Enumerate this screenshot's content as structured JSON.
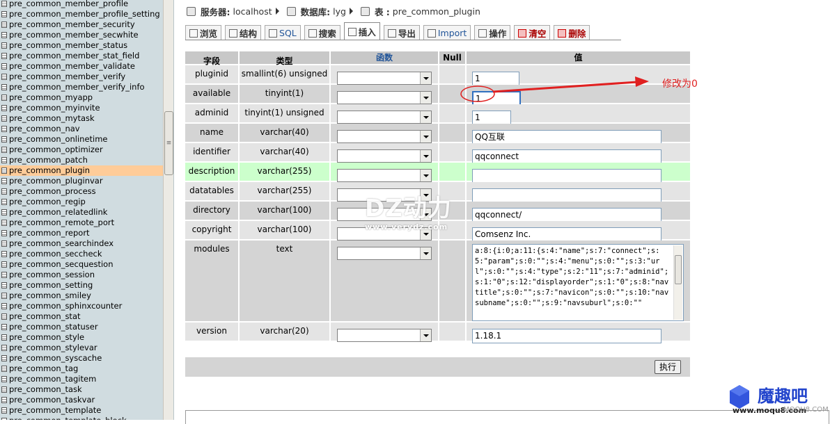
{
  "sidebar": {
    "tables": [
      "pre_common_member_profile",
      "pre_common_member_profile_setting",
      "pre_common_member_security",
      "pre_common_member_secwhite",
      "pre_common_member_status",
      "pre_common_member_stat_field",
      "pre_common_member_validate",
      "pre_common_member_verify",
      "pre_common_member_verify_info",
      "pre_common_myapp",
      "pre_common_myinvite",
      "pre_common_mytask",
      "pre_common_nav",
      "pre_common_onlinetime",
      "pre_common_optimizer",
      "pre_common_patch",
      "pre_common_plugin",
      "pre_common_pluginvar",
      "pre_common_process",
      "pre_common_regip",
      "pre_common_relatedlink",
      "pre_common_remote_port",
      "pre_common_report",
      "pre_common_searchindex",
      "pre_common_seccheck",
      "pre_common_secquestion",
      "pre_common_session",
      "pre_common_setting",
      "pre_common_smiley",
      "pre_common_sphinxcounter",
      "pre_common_stat",
      "pre_common_statuser",
      "pre_common_style",
      "pre_common_stylevar",
      "pre_common_syscache",
      "pre_common_tag",
      "pre_common_tagitem",
      "pre_common_task",
      "pre_common_taskvar",
      "pre_common_template",
      "pre_common_template_block"
    ],
    "selected": "pre_common_plugin"
  },
  "breadcrumb": {
    "server_label": "服务器:",
    "server": "localhost",
    "db_label": "数据库:",
    "db": "lyg",
    "table_label": "表 :",
    "table": "pre_common_plugin"
  },
  "tabs": [
    "浏览",
    "结构",
    "SQL",
    "搜索",
    "插入",
    "导出",
    "Import",
    "操作",
    "清空",
    "删除"
  ],
  "grid": {
    "headers": [
      "字段",
      "类型",
      "函数",
      "Null",
      "值"
    ],
    "rows": [
      {
        "field": "pluginid",
        "type": "smallint(6) unsigned",
        "value": "1"
      },
      {
        "field": "available",
        "type": "tinyint(1)",
        "value": "1"
      },
      {
        "field": "adminid",
        "type": "tinyint(1) unsigned",
        "value": "1"
      },
      {
        "field": "name",
        "type": "varchar(40)",
        "value": "QQ互联"
      },
      {
        "field": "identifier",
        "type": "varchar(40)",
        "value": "qqconnect"
      },
      {
        "field": "description",
        "type": "varchar(255)",
        "value": ""
      },
      {
        "field": "datatables",
        "type": "varchar(255)",
        "value": ""
      },
      {
        "field": "directory",
        "type": "varchar(100)",
        "value": "qqconnect/"
      },
      {
        "field": "copyright",
        "type": "varchar(100)",
        "value": "Comsenz Inc."
      },
      {
        "field": "modules",
        "type": "text",
        "value": "a:8:{i:0;a:11:{s:4:\"name\";s:7:\"connect\";s:5:\"param\";s:0:\"\";s:4:\"menu\";s:0:\"\";s:3:\"url\";s:0:\"\";s:4:\"type\";s:2:\"11\";s:7:\"adminid\";s:1:\"0\";s:12:\"displayorder\";s:1:\"0\";s:8:\"navtitle\";s:0:\"\";s:7:\"navicon\";s:0:\"\";s:10:\"navsubname\";s:0:\"\";s:9:\"navsuburl\";s:0:\"\""
      },
      {
        "field": "version",
        "type": "varchar(20)",
        "value": "1.18.1"
      }
    ]
  },
  "execute_label": "执行",
  "annotation": "修改为0",
  "watermark": {
    "title": "DZ动力",
    "url": "www.verydz.com"
  },
  "logo": {
    "text": "魔趣吧",
    "url": "www.moqu8.com",
    "url_faint": "MOQU8.COM"
  },
  "colors": {
    "sidebar_bg": "#d0dce0",
    "selected_row": "#ffcc99",
    "highlight_row": "#ccffcc",
    "annotation": "#e02020"
  }
}
